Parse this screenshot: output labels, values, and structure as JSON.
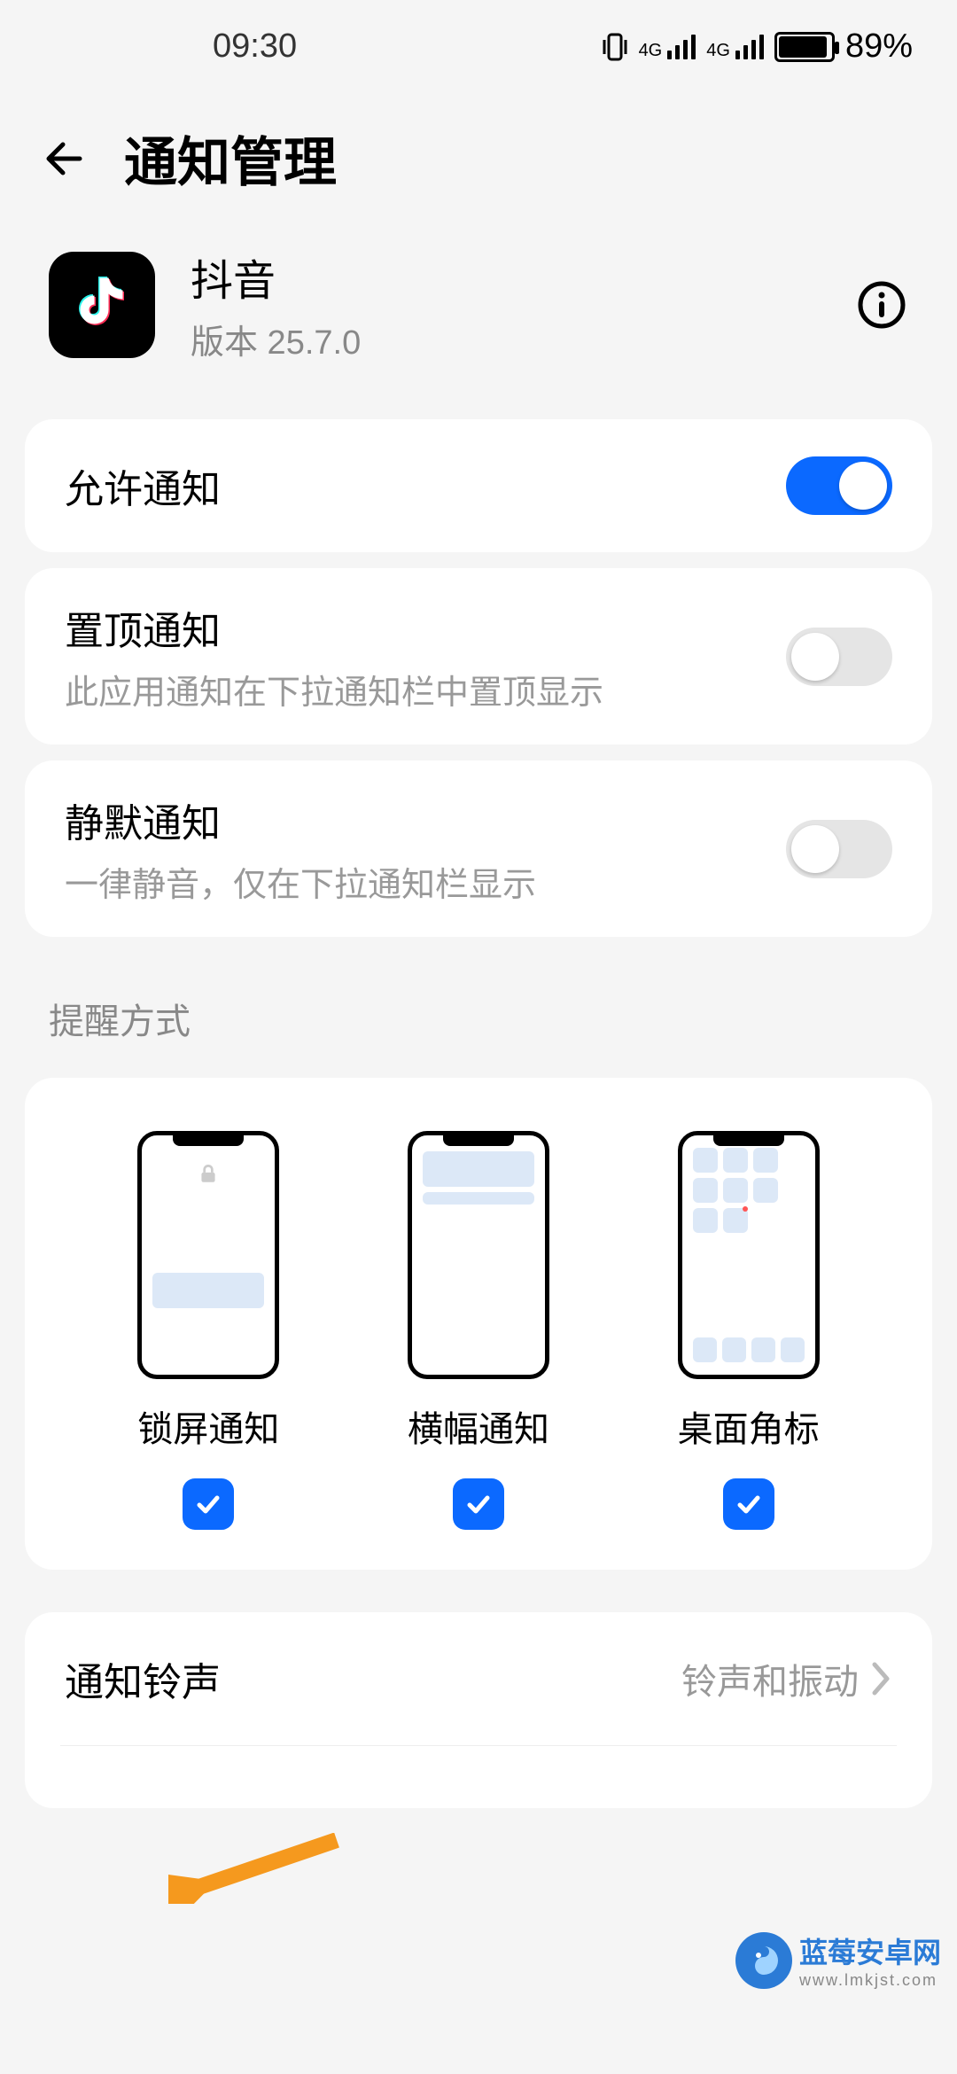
{
  "status": {
    "time": "09:30",
    "battery_pct": "89%",
    "signal1": "4G",
    "signal2": "4G"
  },
  "header": {
    "title": "通知管理"
  },
  "app": {
    "name": "抖音",
    "version": "版本 25.7.0"
  },
  "settings": {
    "allow": {
      "title": "允许通知",
      "on": true
    },
    "pin": {
      "title": "置顶通知",
      "sub": "此应用通知在下拉通知栏中置顶显示",
      "on": false
    },
    "silent": {
      "title": "静默通知",
      "sub": "一律静音，仅在下拉通知栏显示",
      "on": false
    }
  },
  "section": {
    "alert_mode_title": "提醒方式"
  },
  "modes": {
    "lockscreen": {
      "label": "锁屏通知",
      "checked": true
    },
    "banner": {
      "label": "横幅通知",
      "checked": true
    },
    "badge": {
      "label": "桌面角标",
      "checked": true
    }
  },
  "ringtone": {
    "title": "通知铃声",
    "value": "铃声和振动"
  },
  "watermark": {
    "name": "蓝莓安卓网",
    "url": "www.lmkjst.com"
  },
  "colors": {
    "accent": "#0b69ff",
    "arrow": "#f5991e"
  }
}
